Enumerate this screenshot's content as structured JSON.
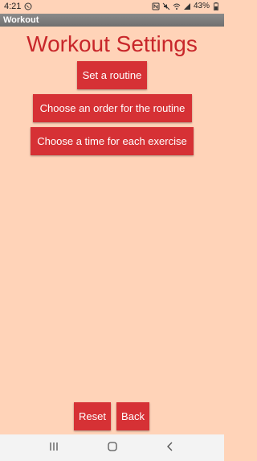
{
  "status_bar": {
    "time": "4:21",
    "battery": "43%"
  },
  "app_bar": {
    "title": "Workout"
  },
  "main": {
    "title": "Workout Settings",
    "buttons": {
      "set_routine": "Set a routine",
      "choose_order": "Choose an order for the routine",
      "choose_time": "Choose a time for each exercise"
    }
  },
  "footer": {
    "reset": "Reset",
    "back": "Back"
  },
  "colors": {
    "background": "#ffd3b8",
    "accent": "#d63135",
    "title": "#c8262a",
    "app_bar": "#7d7d7d"
  },
  "icons": {
    "status_left": [
      "whatsapp-icon"
    ],
    "status_right": [
      "nfc-icon",
      "mute-icon",
      "wifi-icon",
      "signal-icon",
      "battery-icon"
    ],
    "nav": [
      "recents-icon",
      "home-icon",
      "back-icon"
    ]
  }
}
